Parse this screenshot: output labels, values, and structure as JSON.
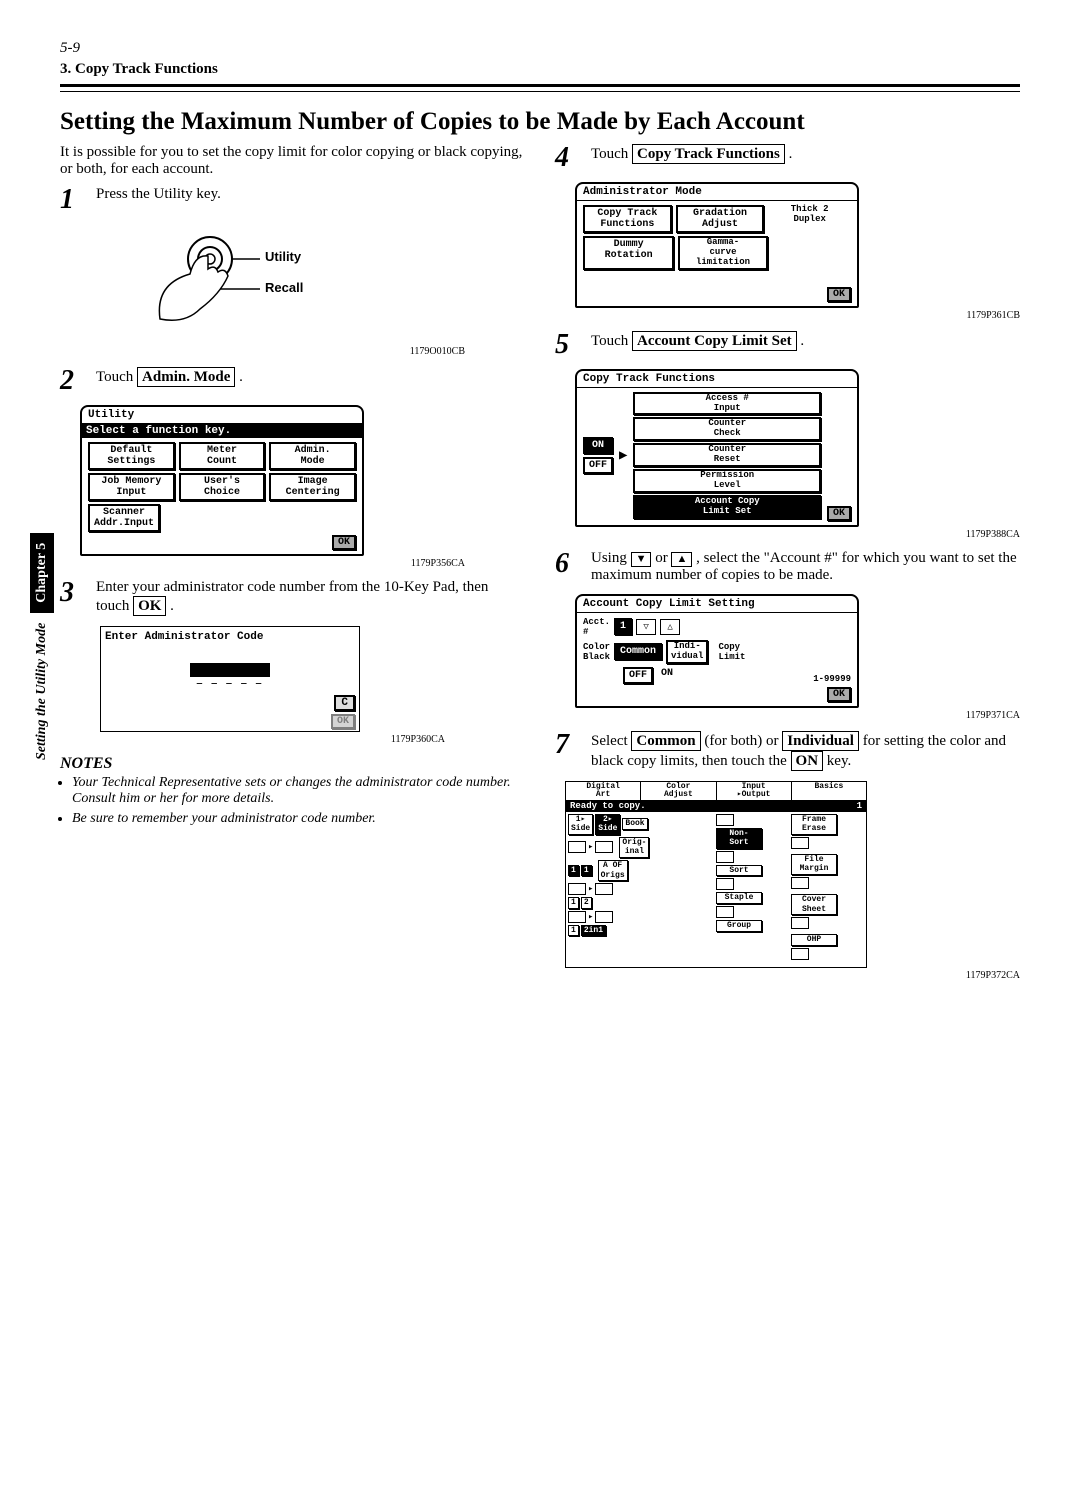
{
  "page": {
    "num": "5-9",
    "section": "3. Copy Track Functions"
  },
  "side": {
    "chapter": "Chapter 5",
    "mode": "Setting the Utility Mode"
  },
  "title": "Setting the Maximum Number of Copies to be Made by Each Account",
  "intro": "It is possible for you to set the copy limit  for color copying or black copying, or both, for each account.",
  "steps": {
    "s1": "Press the Utility key.",
    "s2a": "Touch ",
    "s2b": "Admin. Mode",
    "s2c": " .",
    "s3a": "Enter your administrator code number from the 10-Key Pad, then touch ",
    "s3b": "OK",
    "s3c": " .",
    "s4a": "Touch ",
    "s4b": "Copy Track Functions",
    "s4c": " .",
    "s5a": "Touch ",
    "s5b": "Account Copy Limit Set",
    "s5c": " .",
    "s6a": "Using ",
    "s6b": " or ",
    "s6c": " , select the \"Account #\" for which you want to set the maximum number of copies to be made.",
    "s7a": "Select ",
    "s7b": "Common",
    "s7c": " (for both) or ",
    "s7d": "Individual",
    "s7e": " for setting the color and black copy limits, then touch the ",
    "s7f": "ON",
    "s7g": " key."
  },
  "utility": {
    "label1": "Utility",
    "label2": "Recall",
    "cap": "1179O010CB"
  },
  "screen2": {
    "title": "Utility",
    "subtitle": "Select a function key.",
    "r1": [
      "Default\nSettings",
      "Meter\nCount",
      "Admin.\nMode"
    ],
    "r2": [
      "Job Memory\nInput",
      "User's\nChoice",
      "Image\nCentering"
    ],
    "r3": [
      "Scanner\nAddr.Input"
    ],
    "ok": "OK",
    "cap": "1179P356CA"
  },
  "screen3": {
    "title": "Enter Administrator Code",
    "c": "C",
    "ok": "OK",
    "cap": "1179P360CA"
  },
  "notes": {
    "head": "NOTES",
    "n1": "Your Technical Representative sets or changes the administrator code number. Consult him or her for more details.",
    "n2": "Be sure to remember your administrator code number."
  },
  "screen4": {
    "title": "Administrator Mode",
    "r1": [
      "Copy Track\nFunctions",
      "Gradation\nAdjust",
      "Thick 2\nDuplex"
    ],
    "r2": [
      "Dummy\nRotation",
      "Gamma-\ncurve\nlimitation"
    ],
    "ok": "OK",
    "cap": "1179P361CB"
  },
  "screen5": {
    "title": "Copy Track Functions",
    "on": "ON",
    "off": "OFF",
    "opts": [
      "Access #\nInput",
      "Counter\nCheck",
      "Counter\nReset",
      "Permission\nLevel",
      "Account Copy\nLimit Set"
    ],
    "ok": "OK",
    "cap": "1179P388CA"
  },
  "screen6": {
    "title": "Account Copy Limit Setting",
    "acct": "Acct.\n#",
    "acctval": "1",
    "cb": "Color\nBlack",
    "common": "Common",
    "indiv": "Indi-\nvidual",
    "cl": "Copy\nLimit",
    "off": "OFF",
    "on": "ON",
    "range": "1-99999",
    "ok": "OK",
    "cap": "1179P371CA"
  },
  "screen7": {
    "tabs": [
      "Digital\nArt",
      "Color\nAdjust",
      "Input\n▸Output",
      "Basics"
    ],
    "status": "Ready to copy.",
    "count": "1",
    "left": {
      "r1": [
        "1▸\nSide",
        "2▸\nSide",
        "Book"
      ],
      "orig": "Orig-\ninal",
      "aob": "A OF\nOrigs"
    },
    "mid": [
      "Non-\nSort",
      "Sort",
      "Staple",
      "Group"
    ],
    "right": [
      "Frame\nErase",
      "File\nMargin",
      "Cover\nSheet",
      "OHP"
    ],
    "nums": {
      "one": "1",
      "two": "2",
      "twoin1": "2in1"
    },
    "cap": "1179P372CA"
  }
}
